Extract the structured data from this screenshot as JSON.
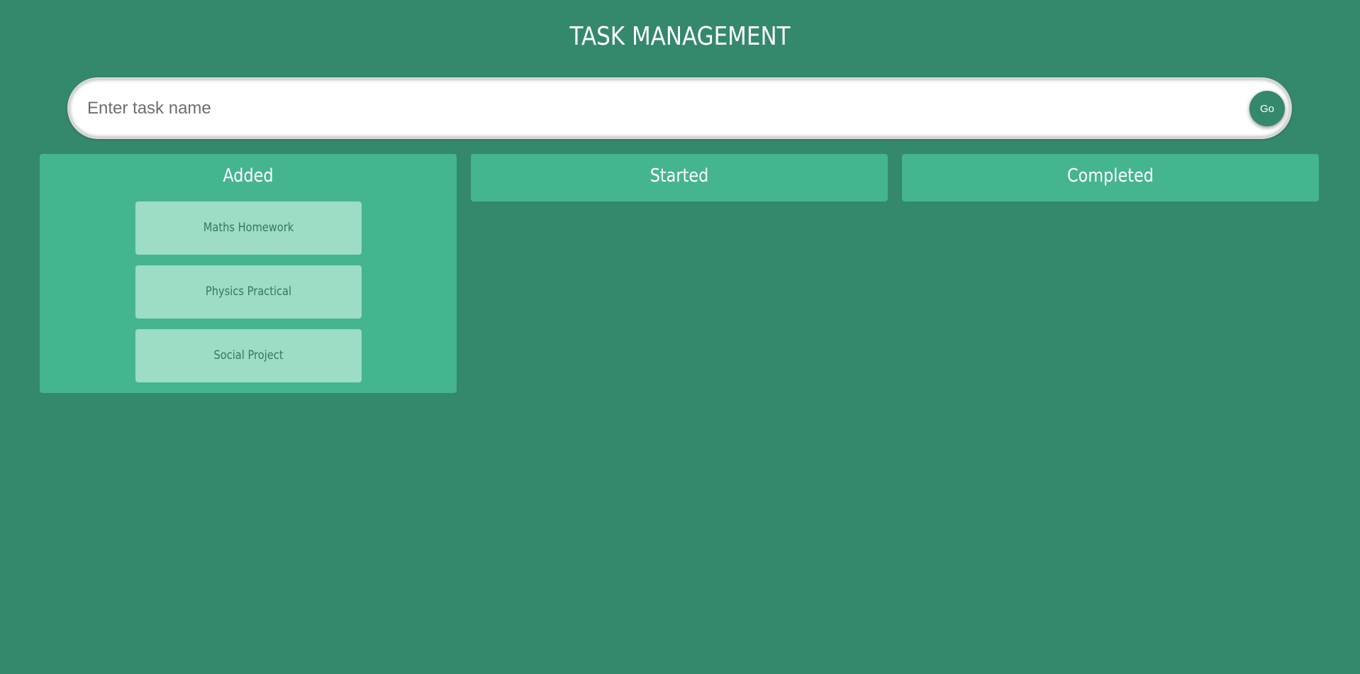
{
  "header": {
    "title": "TASK MANAGEMENT"
  },
  "task_form": {
    "input_value": "",
    "input_placeholder": "Enter task name",
    "submit_label": "Go"
  },
  "columns": [
    {
      "title": "Added",
      "tasks": [
        {
          "label": "Maths Homework"
        },
        {
          "label": "Physics Practical"
        },
        {
          "label": "Social Project"
        }
      ]
    },
    {
      "title": "Started",
      "tasks": []
    },
    {
      "title": "Completed",
      "tasks": []
    }
  ],
  "colors": {
    "background": "#34886b",
    "column": "#45b58f",
    "card": "#9ddcc5",
    "card_text": "#2e7a60",
    "text": "#ffffff"
  }
}
